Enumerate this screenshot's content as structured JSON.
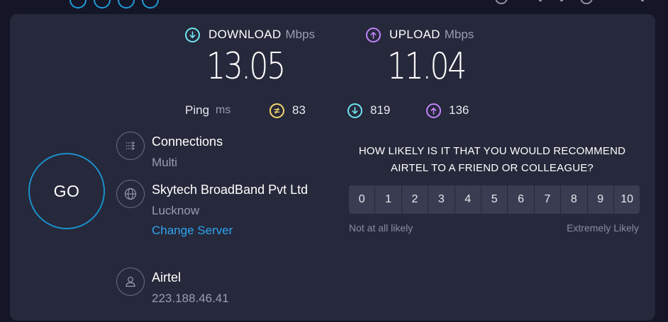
{
  "colors": {
    "download": "#6ee7f0",
    "upload": "#c084fc",
    "ping": "#f5d76e",
    "accent": "#1a90c9",
    "link": "#2ea5f0"
  },
  "download": {
    "label": "DOWNLOAD",
    "unit": "Mbps",
    "value": "13.05"
  },
  "upload": {
    "label": "UPLOAD",
    "unit": "Mbps",
    "value": "11.04"
  },
  "ping": {
    "label": "Ping",
    "unit": "ms",
    "idle": "83",
    "download_latency": "819",
    "upload_latency": "136"
  },
  "go_button": {
    "label": "GO"
  },
  "connections": {
    "title": "Connections",
    "value": "Multi",
    "icon": "connections-icon"
  },
  "server": {
    "title": "Skytech BroadBand Pvt Ltd",
    "location": "Lucknow",
    "change_label": "Change Server",
    "icon": "globe-icon"
  },
  "provider": {
    "title": "Airtel",
    "ip": "223.188.46.41",
    "icon": "user-icon"
  },
  "survey": {
    "question": "HOW LIKELY IS IT THAT YOU WOULD RECOMMEND AIRTEL TO A FRIEND OR COLLEAGUE?",
    "scale": [
      "0",
      "1",
      "2",
      "3",
      "4",
      "5",
      "6",
      "7",
      "8",
      "9",
      "10"
    ],
    "low_label": "Not at all likely",
    "high_label": "Extremely Likely"
  }
}
